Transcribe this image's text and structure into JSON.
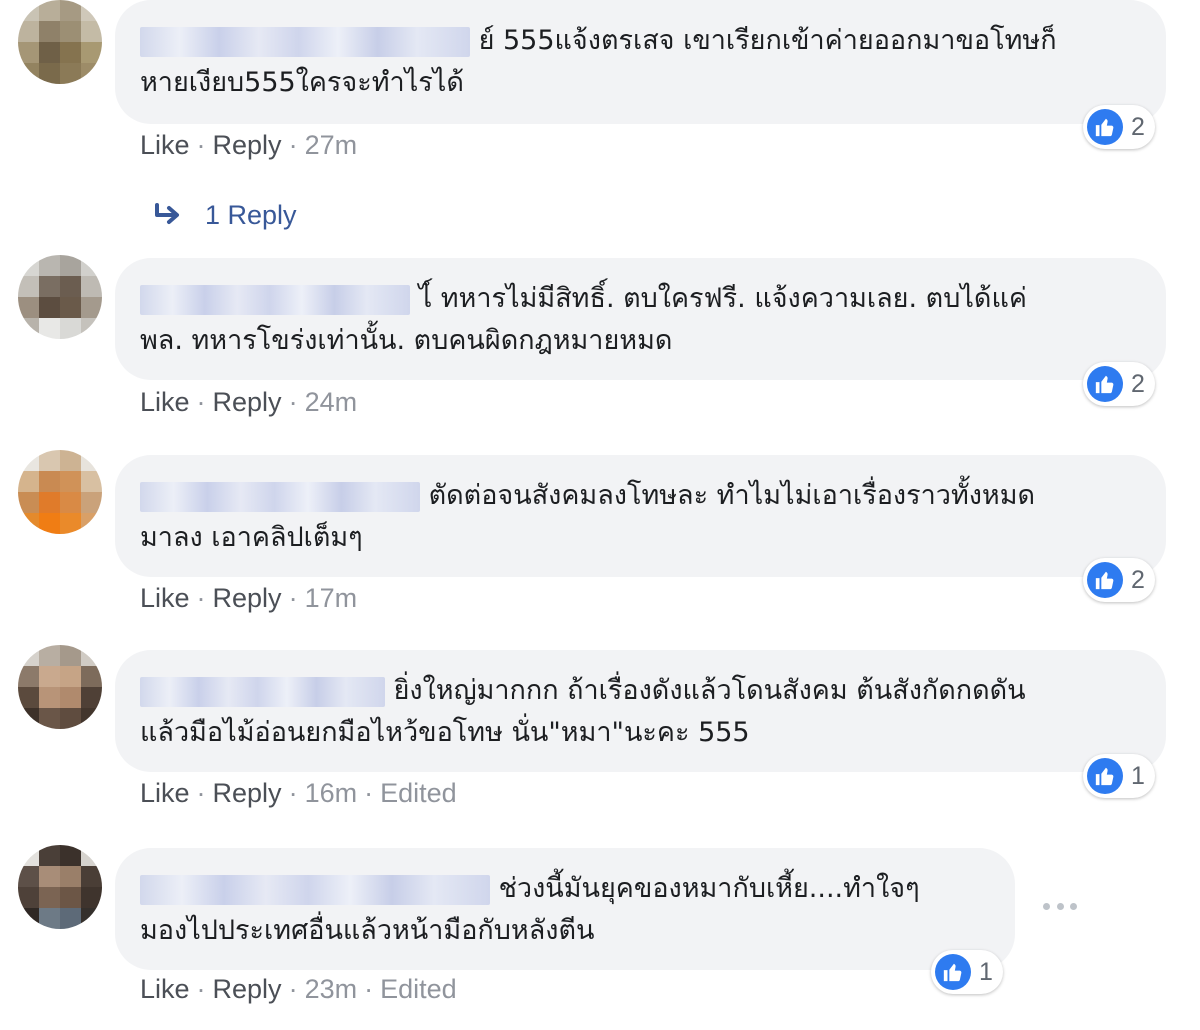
{
  "comments": [
    {
      "line1": "ย์ 555แจ้งตรเสจ เขาเรียกเข้าค่ายออกมาขอโทษก็",
      "line2": "หายเงียบ555ใครจะทำไรได้",
      "like": "Like",
      "reply": "Reply",
      "time": "27m",
      "reaction_count": "2",
      "replies_label": "1 Reply"
    },
    {
      "line1": "ไ์ ทหารไม่มีสิทธิ์. ตบใครฟรี. แจ้งความเลย. ตบได้แค่",
      "line2": "พล. ทหารโขร่งเท่านั้น. ตบคนผิดกฎหมายหมด",
      "like": "Like",
      "reply": "Reply",
      "time": "24m",
      "reaction_count": "2"
    },
    {
      "line1": "ตัดต่อจนสังคมลงโทษละ ทำไมไม่เอาเรื่องราวทั้งหมด",
      "line2": "มาลง เอาคลิปเต็มๆ",
      "like": "Like",
      "reply": "Reply",
      "time": "17m",
      "reaction_count": "2"
    },
    {
      "line1": "ยิ่งใหญ่มากกก ถ้าเรื่องดังแล้วโดนสังคม ต้นสังกัดกดดัน",
      "line2": "แล้วมือไม้อ่อนยกมือไหว้ขอโทษ นั่น\"หมา\"นะคะ 555",
      "like": "Like",
      "reply": "Reply",
      "time": "16m",
      "edited": "Edited",
      "reaction_count": "1"
    },
    {
      "line1": "ช่วงนี้มันยุคของหมากับเหี้ย....ทำใจๆ",
      "line2": "มองไปประเทศอื่นแล้วหน้ามือกับหลังตีน",
      "like": "Like",
      "reply": "Reply",
      "time": "23m",
      "edited": "Edited",
      "reaction_count": "1"
    }
  ],
  "separator": "·",
  "colors": {
    "like_blue": "#2e7bf0",
    "bubble_bg": "#f2f3f5",
    "link_blue": "#385898"
  }
}
